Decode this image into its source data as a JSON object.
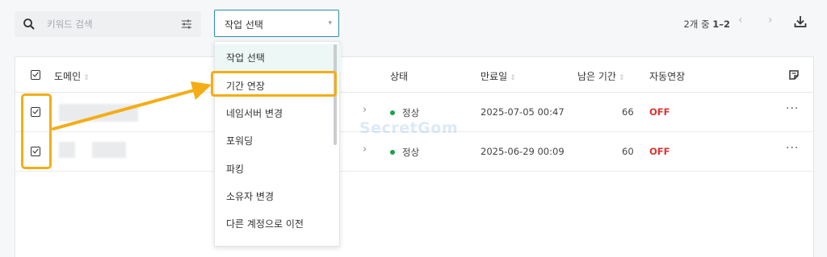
{
  "search": {
    "placeholder": "키워드 검색",
    "icon": "search-icon",
    "filter_icon": "sliders-icon"
  },
  "job_select": {
    "value": "작업 선택",
    "caret": "▾"
  },
  "pagination": {
    "range_prefix": "2개 중 ",
    "range": "1–2",
    "prev": "‹",
    "next": "›",
    "download_icon": "download-icon"
  },
  "table": {
    "columns": {
      "domain": "도메인",
      "status": "상태",
      "expiry": "만료일",
      "remaining": "남은 기간",
      "auto_renew": "자동연장",
      "sort_glyph": "⇕"
    },
    "rows": [
      {
        "status": "정상",
        "expiry": "2025-07-05 00:47",
        "remaining": "66",
        "auto_renew": "OFF",
        "more": "···",
        "chev": "›"
      },
      {
        "status": "정상",
        "expiry": "2025-06-29 00:09",
        "remaining": "60",
        "auto_renew": "OFF",
        "more": "···",
        "chev": "›"
      }
    ]
  },
  "dropdown": {
    "items": [
      "작업 선택",
      "기간 연장",
      "네임서버 변경",
      "포워딩",
      "파킹",
      "소유자 변경",
      "다른 계정으로 이전"
    ]
  },
  "watermark": "SecretGom",
  "colors": {
    "accent": "#2d8fa5",
    "highlight": "#f4ad16",
    "status_ok": "#17a34a",
    "off": "#e0332f"
  }
}
